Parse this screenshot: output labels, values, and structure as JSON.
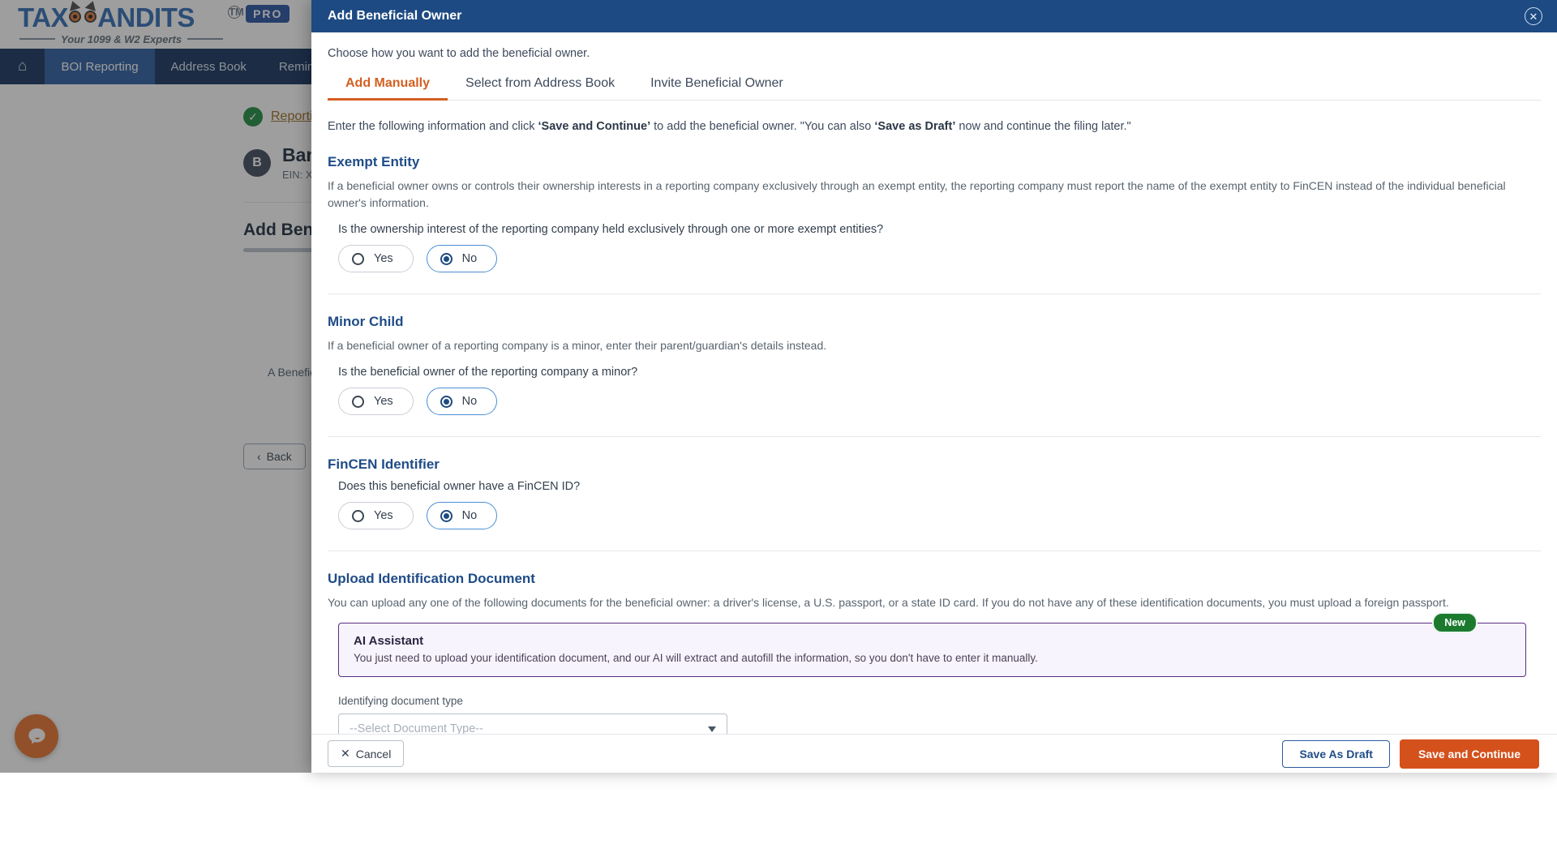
{
  "brand": {
    "logo_text_1": "TAX",
    "logo_text_2": "ANDITS",
    "trademark": "TM",
    "pro_badge": "PRO",
    "tagline": "Your 1099 & W2 Experts"
  },
  "nav": {
    "home_icon": "home-icon",
    "items": [
      {
        "label": "BOI Reporting",
        "active": true
      },
      {
        "label": "Address Book",
        "active": false
      },
      {
        "label": "Reminders",
        "active": false
      }
    ]
  },
  "background": {
    "breadcrumb": "Reporting Company",
    "company_initial": "B",
    "company_name": "Bands",
    "company_ein": "EIN: X",
    "section_heading": "Add Beneficial Owner",
    "placeholder_note": "A Beneficial Owner",
    "back_button": "Back",
    "back_icon": "chevron-left-icon",
    "chat_icon": "chat-bubble-icon"
  },
  "modal": {
    "title": "Add Beneficial Owner",
    "close_icon": "close-icon",
    "lead": "Choose how you want to add the beneficial owner.",
    "tabs": [
      {
        "label": "Add Manually",
        "active": true
      },
      {
        "label": "Select from Address Book",
        "active": false
      },
      {
        "label": "Invite Beneficial Owner",
        "active": false
      }
    ],
    "instruction_parts": {
      "p1": "Enter the following information and click ",
      "b1": "‘Save and Continue’",
      "p2": " to add the beneficial owner. \"You can also ",
      "b2": "‘Save as Draft’",
      "p3": " now and continue the filing later.\""
    },
    "sections": {
      "exempt_entity": {
        "title": "Exempt Entity",
        "description": "If a beneficial owner owns or controls their ownership interests in a reporting company exclusively through an exempt entity, the reporting company must report the name of the exempt entity to FinCEN instead of the individual beneficial owner's information.",
        "question": "Is the ownership interest of the reporting company held exclusively through one or more exempt entities?",
        "options": [
          {
            "label": "Yes",
            "selected": false
          },
          {
            "label": "No",
            "selected": true
          }
        ]
      },
      "minor_child": {
        "title": "Minor Child",
        "description": "If a beneficial owner of a reporting company is a minor, enter their parent/guardian's details instead.",
        "question": "Is the beneficial owner of the reporting company a minor?",
        "options": [
          {
            "label": "Yes",
            "selected": false
          },
          {
            "label": "No",
            "selected": true
          }
        ]
      },
      "fincen_identifier": {
        "title": "FinCEN Identifier",
        "question": "Does this beneficial owner have a FinCEN ID?",
        "options": [
          {
            "label": "Yes",
            "selected": false
          },
          {
            "label": "No",
            "selected": true
          }
        ]
      },
      "upload_document": {
        "title": "Upload Identification Document",
        "description": "You can upload any one of the following documents for the beneficial owner: a driver's license, a U.S. passport, or a state ID card. If you do not have any of these identification documents, you must upload a foreign passport.",
        "new_badge": "New",
        "ai_title": "AI Assistant",
        "ai_description": "You just need to upload your identification document, and our AI will extract and autofill the information, so you don't have to enter it manually.",
        "field_label": "Identifying document type",
        "select_value": "--Select Document Type--",
        "select_caret_icon": "chevron-down-icon",
        "upload_icon": "upload-cloud-icon"
      }
    },
    "footer": {
      "cancel_label": "Cancel",
      "cancel_icon": "close-x-icon",
      "save_draft_label": "Save As Draft",
      "save_continue_label": "Save and Continue"
    }
  },
  "colors": {
    "modal_header": "#1d4a82",
    "accent_orange": "#d4511c",
    "tab_active": "#d45f22",
    "section_title": "#1f4c87",
    "ai_border": "#5a2d82",
    "badge_green": "#1c7a2f",
    "nav_bg": "#12305c"
  }
}
